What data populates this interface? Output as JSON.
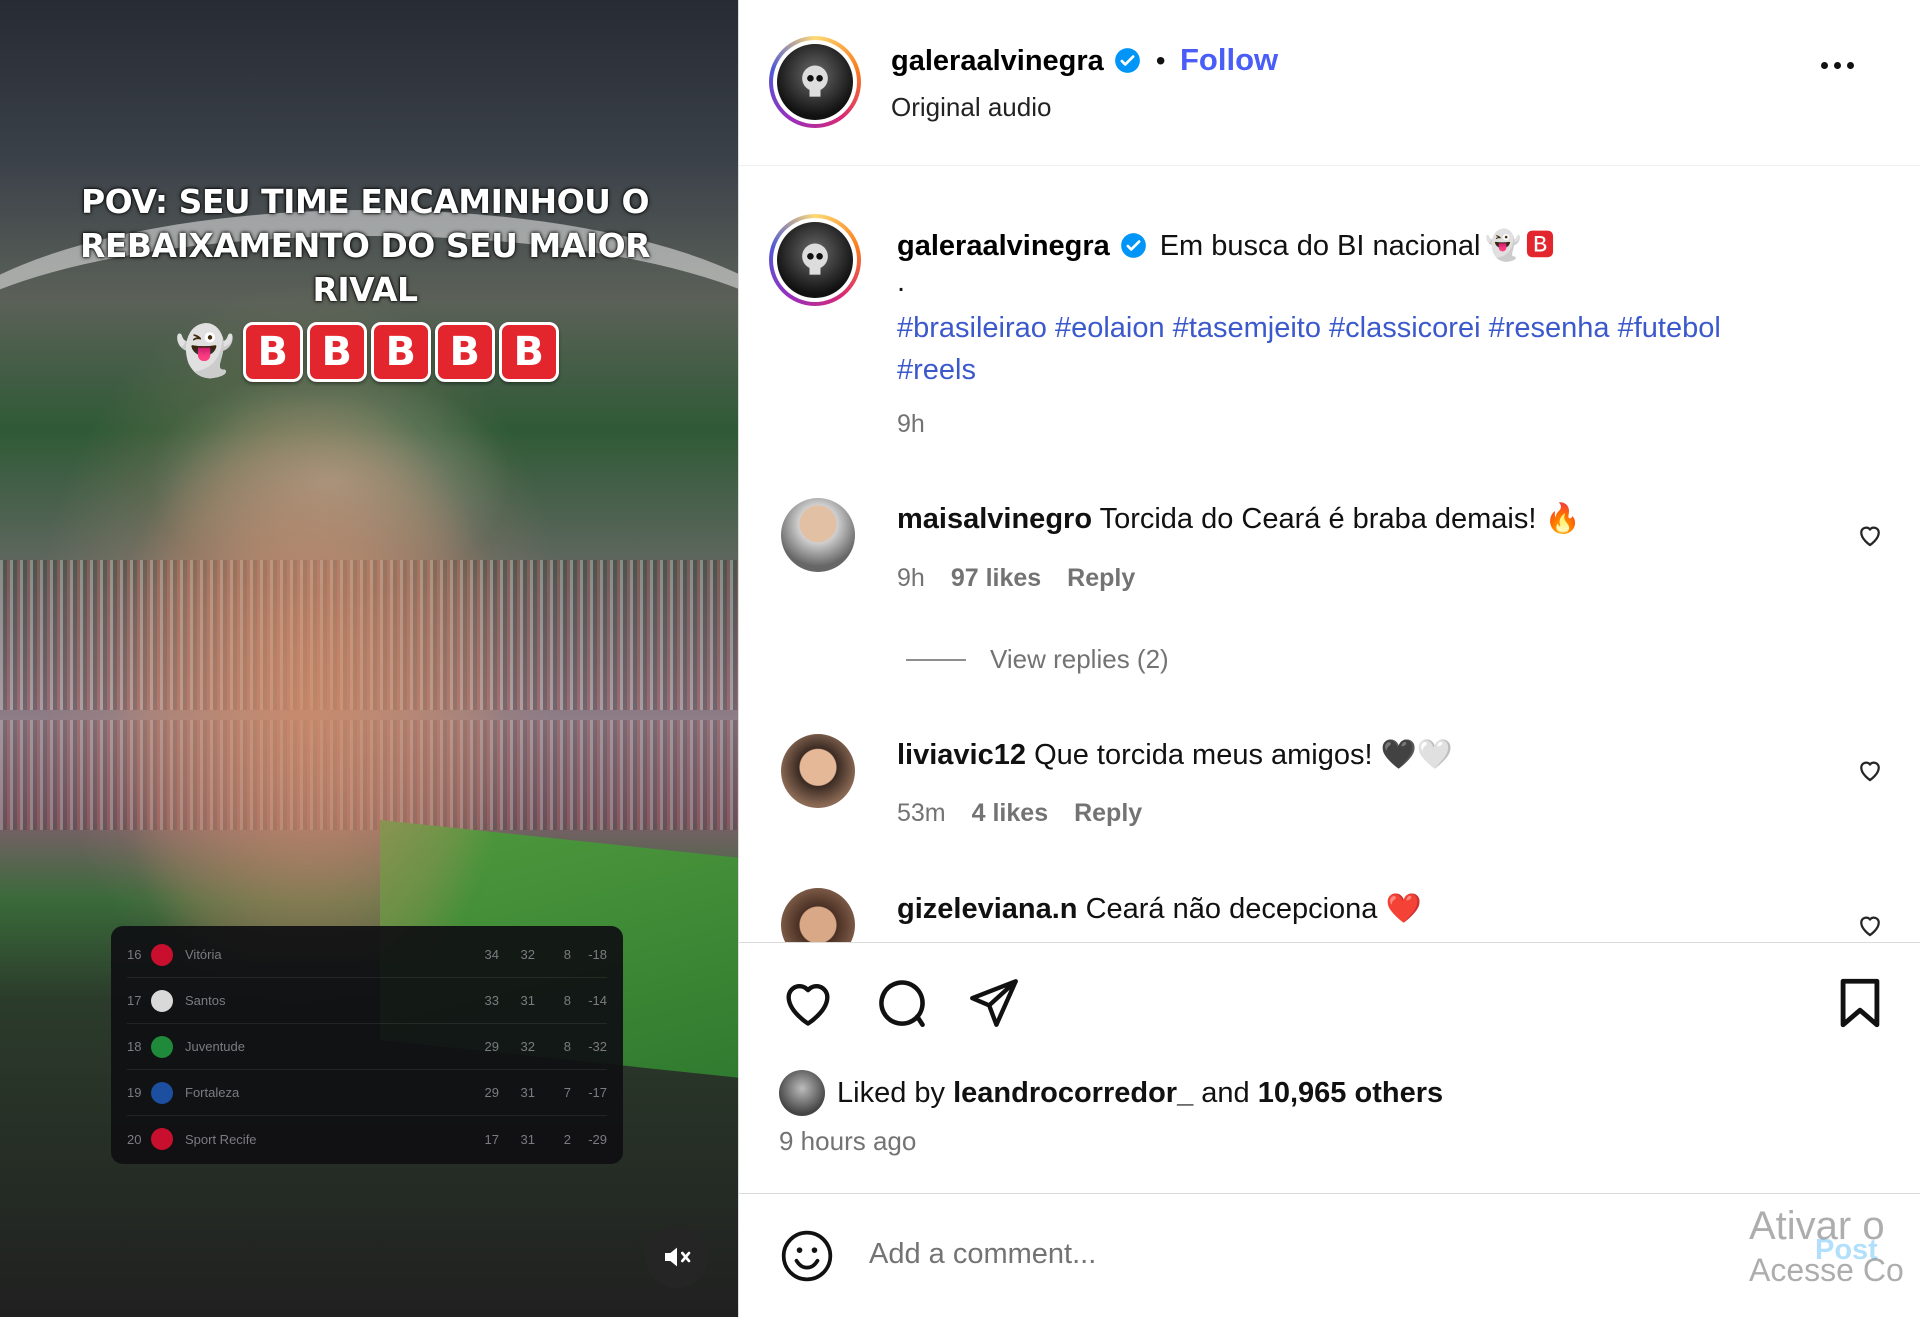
{
  "video": {
    "overlay_caption": "POV: SEU TIME ENCAMINHOU O REBAIXAMENTO DO SEU MAIOR RIVAL",
    "overlay_emoji": "👻",
    "b_tiles": [
      "B",
      "B",
      "B",
      "B",
      "B"
    ],
    "standings": [
      {
        "pos": "16",
        "team": "Vitória",
        "pts": "34",
        "games": "32",
        "wins": "8",
        "gd": "-18",
        "crest_color": "#c8102e"
      },
      {
        "pos": "17",
        "team": "Santos",
        "pts": "33",
        "games": "31",
        "wins": "8",
        "gd": "-14",
        "crest_color": "#d9d9d9"
      },
      {
        "pos": "18",
        "team": "Juventude",
        "pts": "29",
        "games": "32",
        "wins": "8",
        "gd": "-32",
        "crest_color": "#1f8a3a"
      },
      {
        "pos": "19",
        "team": "Fortaleza",
        "pts": "29",
        "games": "31",
        "wins": "7",
        "gd": "-17",
        "crest_color": "#1c4fa0"
      },
      {
        "pos": "20",
        "team": "Sport Recife",
        "pts": "17",
        "games": "31",
        "wins": "2",
        "gd": "-29",
        "crest_color": "#c8102e"
      }
    ],
    "mute_icon": "speaker-muted-icon"
  },
  "header": {
    "username": "galeraalvinegra",
    "separator": "•",
    "follow_label": "Follow",
    "subtitle": "Original audio",
    "more_icon": "more-options-icon"
  },
  "caption": {
    "username": "galeraalvinegra",
    "text": "Em busca do BI nacional",
    "emoji_1": "👻",
    "emoji_2": "🅱",
    "dot_line": ".",
    "hashtags_line1": "#brasileirao #eolaion #tasemjeito #classicorei #resenha #futebol",
    "hashtags_line2": "#reels",
    "time": "9h"
  },
  "comments": [
    {
      "username": "maisalvinegro",
      "text": "Torcida do Ceará é braba demais!",
      "emoji": "🔥",
      "time": "9h",
      "likes": "97 likes",
      "reply_label": "Reply"
    },
    {
      "username": "liviavic12",
      "text": "Que torcida meus amigos!",
      "emoji": "🖤🤍",
      "time": "53m",
      "likes": "4 likes",
      "reply_label": "Reply"
    },
    {
      "username": "gizeleviana.n",
      "text": "Ceará não decepciona",
      "emoji": "❤️"
    }
  ],
  "view_replies": "View replies (2)",
  "likes": {
    "prefix": "Liked by",
    "user": "leandrocorredor_",
    "middle": "and",
    "count": "10,965 others"
  },
  "posted_ago": "9 hours ago",
  "add_comment": {
    "placeholder": "Add a comment...",
    "post_label": "Post"
  },
  "watermark": {
    "line1": "Ativar o",
    "line2": "Acesse Co"
  },
  "colors": {
    "link_blue": "#4a5df9",
    "hashtag_blue": "#3c59cc",
    "muted_gray": "#737373",
    "verified_blue": "#0095f6",
    "b_red": "#e3262e"
  }
}
